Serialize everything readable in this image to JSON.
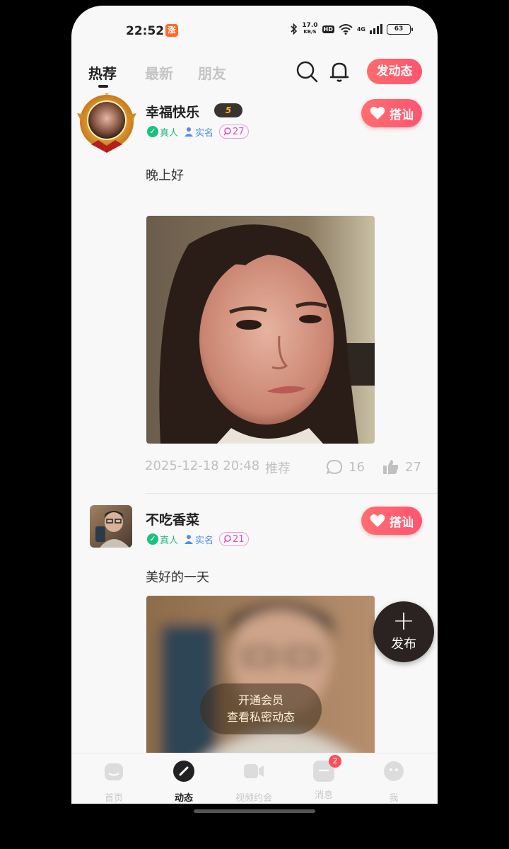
{
  "status_bar": {
    "time": "22:52",
    "app_icon_text": "涨",
    "net_speed_top": "17.0",
    "net_speed_unit": "KB/S",
    "hd": "HD",
    "network": "4G",
    "battery": "63"
  },
  "header": {
    "tabs": [
      {
        "label": "热荐",
        "active": true
      },
      {
        "label": "最新"
      },
      {
        "label": "朋友"
      }
    ],
    "search_icon": "search-icon",
    "bell_icon": "bell-icon",
    "post_button": "发动态"
  },
  "posts": [
    {
      "username": "幸福快乐",
      "vip_badge": "5",
      "badges": {
        "real": "真人",
        "name": "实名",
        "chat_count": "27"
      },
      "greet_button": "搭讪",
      "caption": "晚上好",
      "timestamp": "2025-12-18 20:48",
      "tag": "推荐",
      "comments": "16",
      "likes": "27"
    },
    {
      "username": "不吃香菜",
      "badges": {
        "real": "真人",
        "name": "实名",
        "chat_count": "21"
      },
      "greet_button": "搭讪",
      "caption": "美好的一天"
    }
  ],
  "vip_overlay": {
    "line1": "开通会员",
    "line2": "查看私密动态"
  },
  "fab": {
    "label": "发布"
  },
  "bottom_nav": [
    {
      "label": "首页",
      "icon": "home-icon"
    },
    {
      "label": "动态",
      "icon": "compass-icon",
      "active": true
    },
    {
      "label": "视频约会",
      "icon": "video-icon"
    },
    {
      "label": "消息",
      "icon": "message-icon",
      "badge": "2"
    },
    {
      "label": "我",
      "icon": "profile-icon"
    }
  ],
  "colors": {
    "accent": "#ff5a6e",
    "real": "#1bb97e",
    "name": "#4a8ef0",
    "chat": "#d94fc2"
  }
}
